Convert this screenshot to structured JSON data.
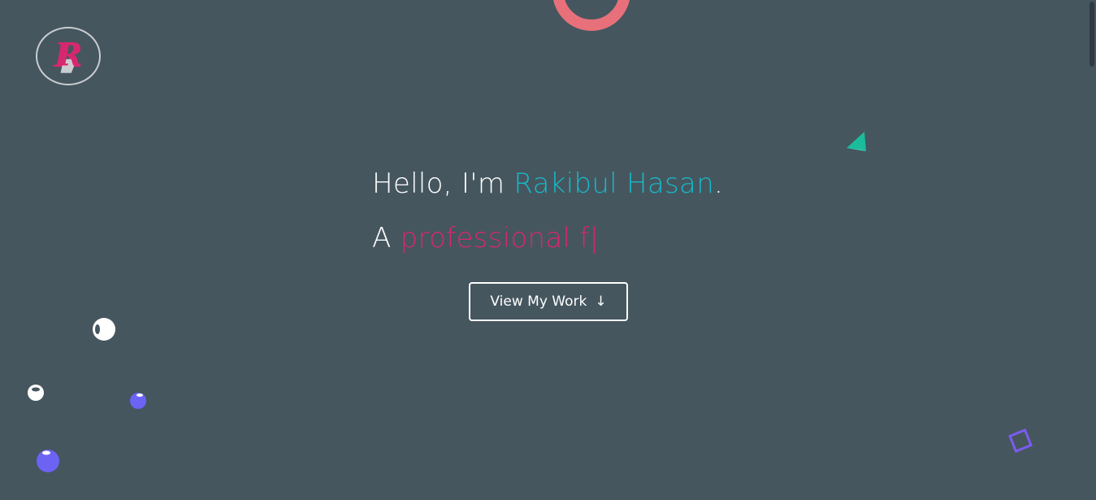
{
  "logo": {
    "letter": "R",
    "icon": "r-logo-icon"
  },
  "hero": {
    "greeting": "Hello, I'm ",
    "name": "Rakibul Hasan",
    "period": ".",
    "prefix": "A ",
    "typed_text": "professional f",
    "cursor": "|"
  },
  "cta": {
    "label": "View My Work",
    "arrow": "↓",
    "icon": "arrow-down-icon"
  },
  "colors": {
    "background": "#45565f",
    "accent_name": "#19b8c6",
    "accent_typed": "#d6286f",
    "ring": "#e8707a",
    "triangle": "#1abc9c",
    "square": "#7b5cf0",
    "bubble_purple": "#6c63f5"
  }
}
